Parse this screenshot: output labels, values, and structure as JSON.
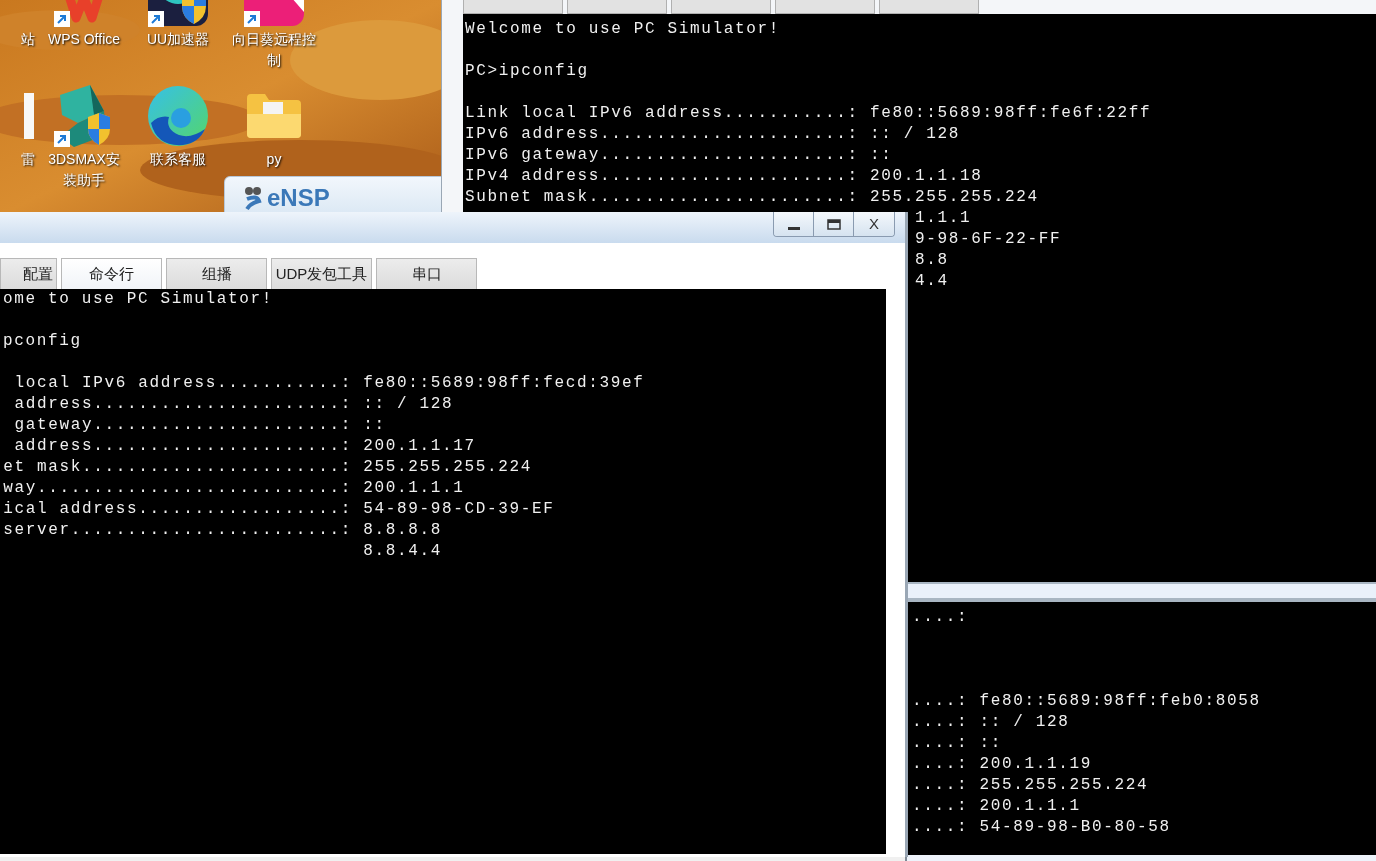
{
  "desktop": {
    "icons": [
      {
        "kind": "cut",
        "label": [
          "站"
        ],
        "shortcut": false
      },
      {
        "kind": "wps",
        "label": [
          "WPS Office"
        ],
        "shortcut": true
      },
      {
        "kind": "uu",
        "label": [
          "UU加速器"
        ],
        "shortcut": true
      },
      {
        "kind": "sunflower",
        "label": [
          "向日葵远程控",
          "制"
        ],
        "shortcut": true
      },
      {
        "kind": "doc",
        "label": [
          "雷"
        ],
        "shortcut": false
      },
      {
        "kind": "max",
        "label": [
          "3DSMAX安",
          "装助手"
        ],
        "shortcut": true
      },
      {
        "kind": "edge",
        "label": [
          "联系客服"
        ],
        "shortcut": false
      },
      {
        "kind": "folder",
        "label": [
          "py"
        ],
        "shortcut": false
      }
    ]
  },
  "ensp_window": {
    "title": "eNSP"
  },
  "back_window": {
    "terminal": [
      {
        "kind": "text",
        "text": "Welcome to use PC Simulator!"
      },
      {
        "kind": "blank"
      },
      {
        "kind": "text",
        "text": "PC>ipconfig"
      },
      {
        "kind": "blank"
      },
      {
        "kind": "field",
        "label": "Link local IPv6 address...........:",
        "value": "fe80::5689:98ff:fe6f:22ff"
      },
      {
        "kind": "field",
        "label": "IPv6 address......................:",
        "value": ":: / 128"
      },
      {
        "kind": "field",
        "label": "IPv6 gateway......................:",
        "value": "::"
      },
      {
        "kind": "field",
        "label": "IPv4 address......................:",
        "value": "200.1.1.18"
      },
      {
        "kind": "field",
        "label": "Subnet mask.......................:",
        "value": "255.255.255.224"
      },
      {
        "kind": "tail",
        "text": "1.1.1"
      },
      {
        "kind": "tail",
        "text": "9-98-6F-22-FF"
      },
      {
        "kind": "tail",
        "text": "8.8"
      },
      {
        "kind": "tail",
        "text": "4.4"
      }
    ]
  },
  "front_window": {
    "close": "X",
    "tabs": [
      {
        "label": "配置",
        "selected": false
      },
      {
        "label": "命令行",
        "selected": true
      },
      {
        "label": "组播",
        "selected": false
      },
      {
        "label": "UDP发包工具",
        "selected": false
      },
      {
        "label": "串口",
        "selected": false
      }
    ],
    "terminal": [
      {
        "kind": "text",
        "text": "ome to use PC Simulator!"
      },
      {
        "kind": "blank"
      },
      {
        "kind": "text",
        "text": "pconfig"
      },
      {
        "kind": "blank"
      },
      {
        "kind": "field",
        "label": "local IPv6 address...........:",
        "value": "fe80::5689:98ff:fecd:39ef"
      },
      {
        "kind": "field",
        "label": "address......................:",
        "value": ":: / 128"
      },
      {
        "kind": "field",
        "label": "gateway......................:",
        "value": "::"
      },
      {
        "kind": "field",
        "label": "address......................:",
        "value": "200.1.1.17"
      },
      {
        "kind": "field",
        "label": "et mask.......................:",
        "value": "255.255.255.224"
      },
      {
        "kind": "field",
        "label": "way...........................:",
        "value": "200.1.1.1"
      },
      {
        "kind": "field",
        "label": "ical address..................:",
        "value": "54-89-98-CD-39-EF"
      },
      {
        "kind": "field",
        "label": "server........................:",
        "value": "8.8.8.8"
      },
      {
        "kind": "field",
        "value": "8.8.4.4"
      }
    ]
  },
  "bottom_window": {
    "terminal": [
      {
        "kind": "text",
        "text": "....:"
      },
      {
        "kind": "blank"
      },
      {
        "kind": "blank"
      },
      {
        "kind": "blank"
      },
      {
        "kind": "field",
        "label": "....:",
        "value": "fe80::5689:98ff:feb0:8058"
      },
      {
        "kind": "field",
        "label": "....:",
        "value": ":: / 128"
      },
      {
        "kind": "field",
        "label": "....:",
        "value": "::"
      },
      {
        "kind": "field",
        "label": "....:",
        "value": "200.1.1.19"
      },
      {
        "kind": "field",
        "label": "....:",
        "value": "255.255.255.224"
      },
      {
        "kind": "field",
        "label": "....:",
        "value": "200.1.1.1"
      },
      {
        "kind": "field",
        "label": "....:",
        "value": "54-89-98-B0-80-58"
      }
    ]
  }
}
